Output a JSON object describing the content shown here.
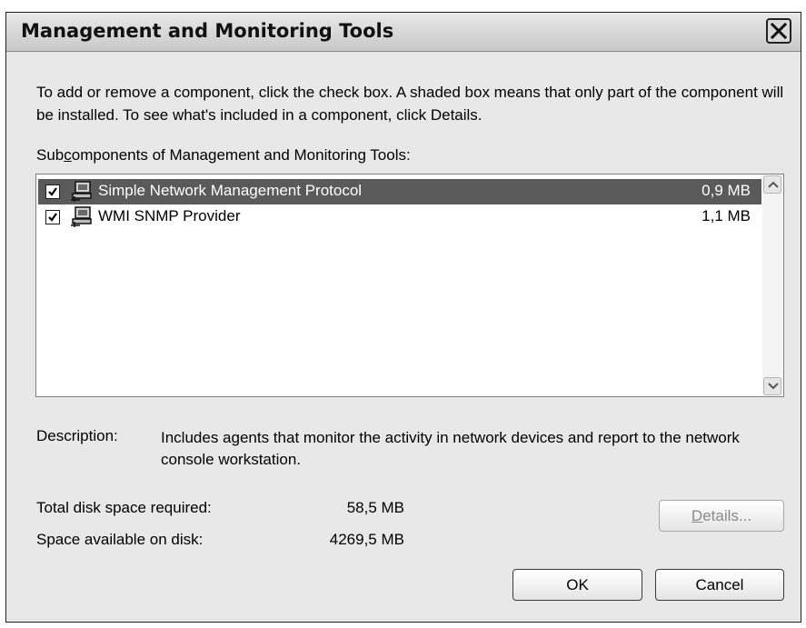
{
  "window": {
    "title": "Management and Monitoring Tools",
    "close_icon": "close-icon"
  },
  "intro_text": "To add or remove a component, click the check box. A shaded box means that only part of the component will be installed. To see what's included in a component, click Details.",
  "subcomponents_label": {
    "before": "Sub",
    "accel": "c",
    "after": "omponents of Management and Monitoring Tools:"
  },
  "components": [
    {
      "name": "Simple Network Management Protocol",
      "size": "0,9 MB",
      "checked": true,
      "selected": true,
      "icon": "network-computer-icon"
    },
    {
      "name": "WMI SNMP Provider",
      "size": "1,1 MB",
      "checked": true,
      "selected": false,
      "icon": "network-computer-icon"
    }
  ],
  "description": {
    "label": "Description:",
    "text": "Includes agents that monitor the activity in network devices and report to the network console workstation."
  },
  "disk": {
    "required_label": "Total disk space required:",
    "required_value": "58,5 MB",
    "available_label": "Space available on disk:",
    "available_value": "4269,5 MB"
  },
  "buttons": {
    "details": {
      "accel": "D",
      "rest": "etails..."
    },
    "ok": "OK",
    "cancel": "Cancel"
  },
  "colors": {
    "selection": "#5a5a5a",
    "dialog_bg": "#ece9d8"
  }
}
